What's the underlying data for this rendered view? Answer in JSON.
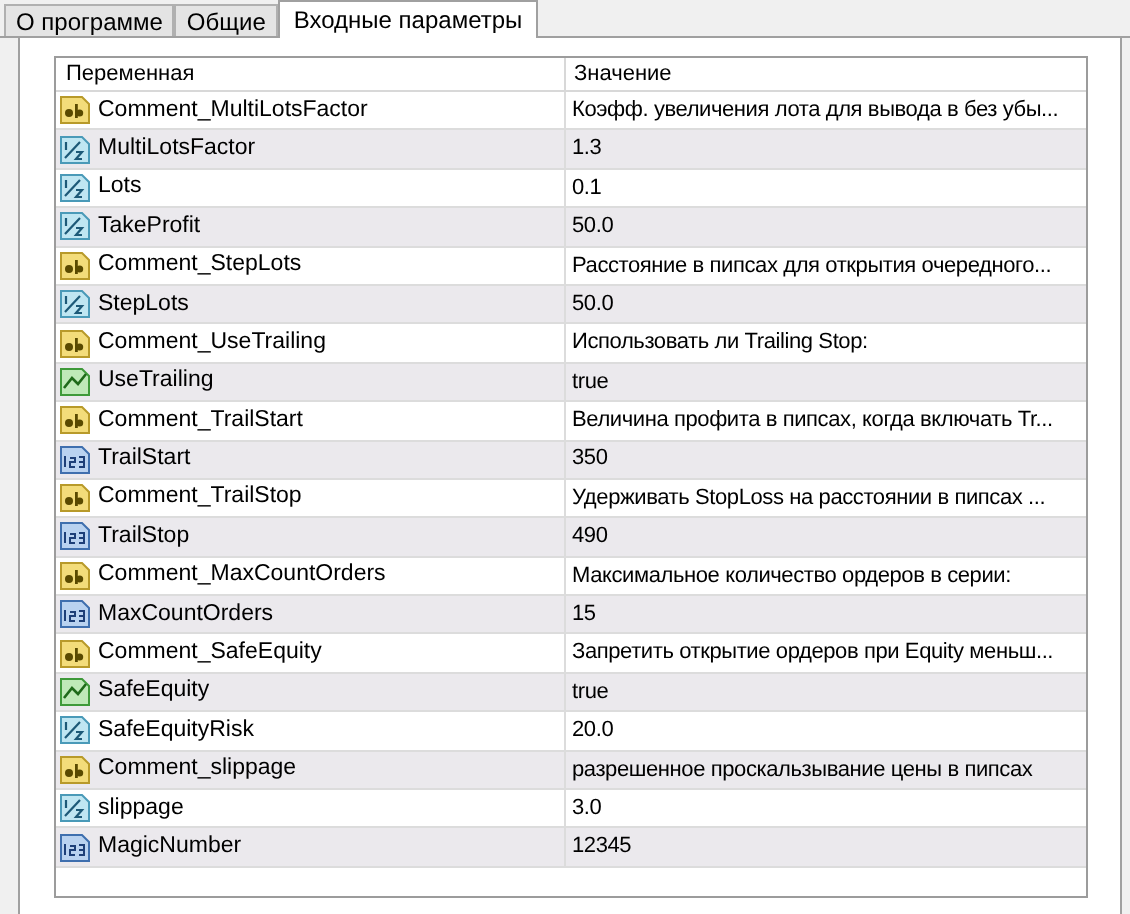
{
  "tabs": [
    {
      "label": "О программе",
      "selected": false
    },
    {
      "label": "Общие",
      "selected": false
    },
    {
      "label": "Входные параметры",
      "selected": true
    }
  ],
  "table": {
    "columns": [
      "Переменная",
      "Значение"
    ],
    "rows": [
      {
        "kind": "string",
        "name": "Comment_MultiLotsFactor",
        "value": "Коэфф. увеличения лота для вывода в без убы..."
      },
      {
        "kind": "double",
        "name": "MultiLotsFactor",
        "value": "1.3"
      },
      {
        "kind": "double",
        "name": "Lots",
        "value": "0.1"
      },
      {
        "kind": "double",
        "name": "TakeProfit",
        "value": "50.0"
      },
      {
        "kind": "string",
        "name": "Comment_StepLots",
        "value": "Расстояние в пипсах для открытия очередного..."
      },
      {
        "kind": "double",
        "name": "StepLots",
        "value": "50.0"
      },
      {
        "kind": "string",
        "name": "Comment_UseTrailing",
        "value": "Использовать ли Trailing Stop:"
      },
      {
        "kind": "bool",
        "name": "UseTrailing",
        "value": "true"
      },
      {
        "kind": "string",
        "name": "Comment_TrailStart",
        "value": "Величина профита в пипсах, когда включать Tr..."
      },
      {
        "kind": "int",
        "name": "TrailStart",
        "value": "350"
      },
      {
        "kind": "string",
        "name": "Comment_TrailStop",
        "value": "Удерживать StopLoss на расстоянии в пипсах ..."
      },
      {
        "kind": "int",
        "name": "TrailStop",
        "value": "490"
      },
      {
        "kind": "string",
        "name": "Comment_MaxCountOrders",
        "value": "Максимальное количество ордеров в серии:"
      },
      {
        "kind": "int",
        "name": "MaxCountOrders",
        "value": "15"
      },
      {
        "kind": "string",
        "name": "Comment_SafeEquity",
        "value": "Запретить открытие ордеров при Equity меньш..."
      },
      {
        "kind": "bool",
        "name": "SafeEquity",
        "value": "true"
      },
      {
        "kind": "double",
        "name": "SafeEquityRisk",
        "value": "20.0"
      },
      {
        "kind": "string",
        "name": "Comment_slippage",
        "value": "разрешенное проскальзывание цены в пипсах"
      },
      {
        "kind": "double",
        "name": "slippage",
        "value": "3.0"
      },
      {
        "kind": "int",
        "name": "MagicNumber",
        "value": "12345"
      }
    ]
  }
}
